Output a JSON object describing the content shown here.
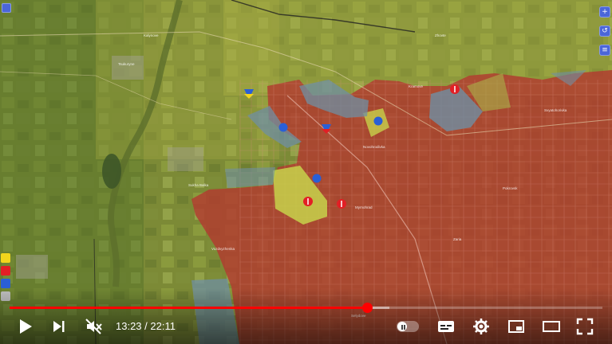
{
  "app": "Video player",
  "colors": {
    "russian_control": "#b23a2f",
    "contested": "#bfcc48",
    "liberated": "#6f8fa3",
    "terrain": "#7d8c3a",
    "progress": "#ff0000"
  },
  "map": {
    "labels": [
      "Kramove",
      "Zhovte",
      "Svyatohorivka",
      "Pokrovsk",
      "Novohrodivka",
      "Myrnohrad",
      "Sukha Balka",
      "Vozdvyzhenka",
      "Zaria",
      "Kalynove",
      "Tsukuryne",
      "Selydove"
    ]
  },
  "controls": {
    "play_icon": "play-icon",
    "next_icon": "next-icon",
    "mute_icon": "volume-muted-icon",
    "time_current": "13:23",
    "time_separator": "/",
    "time_total": "22:11",
    "progress_fraction": 0.603,
    "buffer_fraction": 0.64
  }
}
